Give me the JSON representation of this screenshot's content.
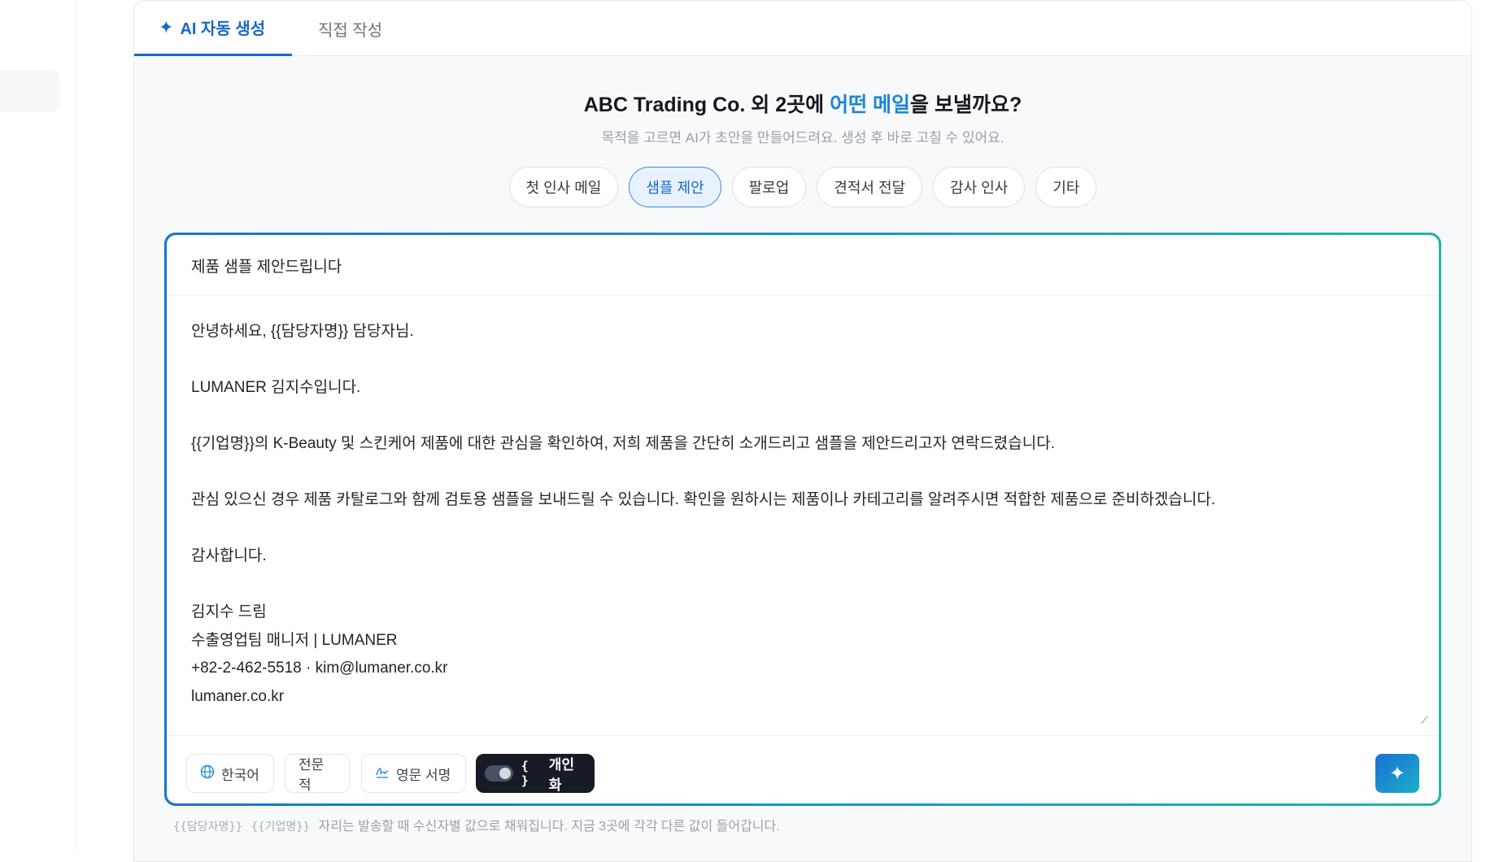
{
  "tabs": [
    {
      "label": "AI 자동 생성",
      "icon": "sparkle-icon",
      "active": true
    },
    {
      "label": "직접 작성",
      "active": false
    }
  ],
  "heading": {
    "prefix": "ABC Trading Co. 외 2곳에 ",
    "accent": "어떤 메일",
    "suffix": "을 보낼까요?",
    "accent_color": "#1a86d4"
  },
  "subheading": "목적을 고르면 AI가 초안을 만들어드려요. 생성 후 바로 고칠 수 있어요.",
  "purposes": [
    {
      "label": "첫 인사 메일",
      "active": false
    },
    {
      "label": "샘플 제안",
      "active": true
    },
    {
      "label": "팔로업",
      "active": false
    },
    {
      "label": "견적서 전달",
      "active": false
    },
    {
      "label": "감사 인사",
      "active": false
    },
    {
      "label": "기타",
      "active": false
    }
  ],
  "editor": {
    "subject": "제품 샘플 제안드립니다",
    "body": {
      "greeting": "안녕하세요, {{담당자명}} 담당자님.",
      "intro": "LUMANER 김지수입니다.",
      "para1": "{{기업명}}의 K-Beauty 및 스킨케어 제품에 대한 관심을 확인하여, 저희 제품을 간단히 소개드리고 샘플을 제안드리고자 연락드렸습니다.",
      "para2": "관심 있으신 경우 제품 카탈로그와 함께 검토용 샘플을 보내드릴 수 있습니다. 확인을 원하시는 제품이나 카테고리를 알려주시면 적합한 제품으로 준비하겠습니다.",
      "closing": "감사합니다.",
      "sign_name": "김지수 드림",
      "sign_title": "수출영업팀 매니저 | LUMANER",
      "sign_contact": "+82-2-462-5518 · kim@lumaner.co.kr",
      "sign_site": "lumaner.co.kr"
    }
  },
  "toolbar": {
    "language": "한국어",
    "language_icon": "globe-icon",
    "tone": "전문적",
    "signature": "영문 서명",
    "signature_icon": "signature-icon",
    "personalize": "개인화",
    "personalize_icon": "{ }",
    "personalize_on": true,
    "generate_icon": "sparkle-icon"
  },
  "hint": {
    "placeholder1": "{{담당자명}}",
    "placeholder2": "{{기업명}}",
    "text": "자리는 발송할 때 수신자별 값으로 채워집니다. 지금 3곳에 각각 다른 값이 들어갑니다."
  },
  "colors": {
    "primary": "#1668c9",
    "accent": "#1a86d4",
    "gradient_end": "#1fb7a6",
    "dark_button": "#161b26"
  }
}
